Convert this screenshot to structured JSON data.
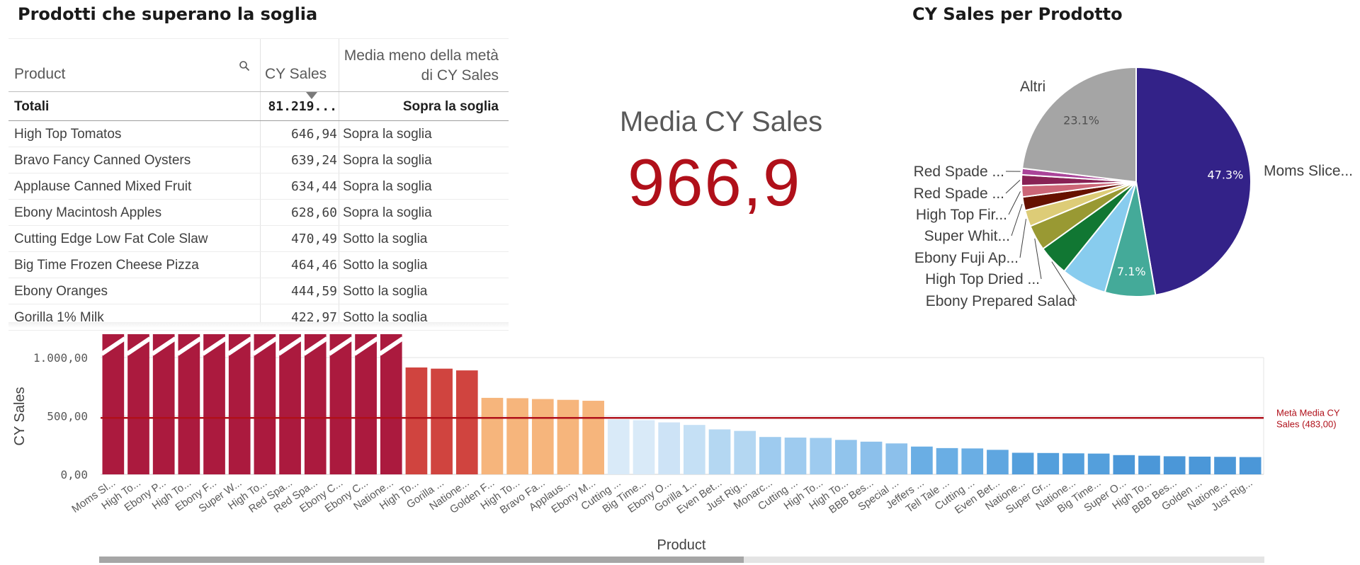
{
  "table": {
    "title": "Prodotti che superano la soglia",
    "headers": {
      "product": "Product",
      "sales": "CY Sales",
      "status": "Media meno della metà di CY Sales"
    },
    "totals": {
      "label": "Totali",
      "sales": "81.219...",
      "status": "Sopra la soglia"
    },
    "rows": [
      {
        "product": "High Top Tomatos",
        "sales": "646,94",
        "status": "Sopra la soglia"
      },
      {
        "product": "Bravo Fancy Canned Oysters",
        "sales": "639,24",
        "status": "Sopra la soglia"
      },
      {
        "product": "Applause Canned Mixed Fruit",
        "sales": "634,44",
        "status": "Sopra la soglia"
      },
      {
        "product": "Ebony Macintosh Apples",
        "sales": "628,60",
        "status": "Sopra la soglia"
      },
      {
        "product": "Cutting Edge Low Fat Cole Slaw",
        "sales": "470,49",
        "status": "Sotto la soglia"
      },
      {
        "product": "Big Time Frozen Cheese Pizza",
        "sales": "464,46",
        "status": "Sotto la soglia"
      },
      {
        "product": "Ebony Oranges",
        "sales": "444,59",
        "status": "Sotto la soglia"
      },
      {
        "product": "Gorilla 1% Milk",
        "sales": "422,97",
        "status": "Sotto la soglia"
      }
    ]
  },
  "kpi": {
    "label": "Media CY Sales",
    "value": "966,9",
    "color": "#b0101a"
  },
  "chart_data": [
    {
      "type": "pie",
      "title": "CY Sales per Prodotto",
      "slices": [
        {
          "label": "Moms Slice...",
          "percent": 47.3,
          "pct_label": "47.3%",
          "color": "#332288"
        },
        {
          "label": "",
          "percent": 7.1,
          "pct_label": "7.1%",
          "color": "#44aa99"
        },
        {
          "label": "",
          "percent": 6.4,
          "pct_label": "",
          "color": "#88ccee"
        },
        {
          "label": "Ebony Prepared Salad",
          "percent": 4.3,
          "pct_label": "",
          "color": "#117733"
        },
        {
          "label": "High Top Dried ...",
          "percent": 3.6,
          "pct_label": "",
          "color": "#999933"
        },
        {
          "label": "Ebony Fuji Ap...",
          "percent": 2.3,
          "pct_label": "",
          "color": "#ddcc77"
        },
        {
          "label": "Super Whit...",
          "percent": 1.9,
          "pct_label": "",
          "color": "#661100"
        },
        {
          "label": "High Top Fir...",
          "percent": 1.6,
          "pct_label": "",
          "color": "#cc6677"
        },
        {
          "label": "Red Spade ...",
          "percent": 1.5,
          "pct_label": "",
          "color": "#882255"
        },
        {
          "label": "Red Spade ...",
          "percent": 0.9,
          "pct_label": "",
          "color": "#aa4499"
        },
        {
          "label": "Altri",
          "percent": 23.1,
          "pct_label": "23.1%",
          "color": "#a5a5a5"
        }
      ]
    },
    {
      "type": "bar",
      "xlabel": "Product",
      "ylabel": "CY Sales",
      "ylim": [
        0,
        1000
      ],
      "yticks": [
        "1.000,00",
        "500,00",
        "0,00"
      ],
      "reference_line": {
        "value": 483,
        "label": "Metà Media CY Sales (483,00)",
        "color": "#b0101a"
      },
      "categories": [
        "Moms Sl...",
        "High To...",
        "Ebony P...",
        "High To...",
        "Ebony F...",
        "Super W...",
        "High To...",
        "Red Spa...",
        "Red Spa...",
        "Ebony C...",
        "Ebony C...",
        "Natione...",
        "High To...",
        "Gorilla ...",
        "Natione...",
        "Golden F...",
        "High To...",
        "Bravo Fa...",
        "Applaus...",
        "Ebony M...",
        "Cutting ...",
        "Big Time...",
        "Ebony O...",
        "Gorilla 1...",
        "Even Bet...",
        "Just Rig...",
        "Monarc...",
        "Cutting ...",
        "High To...",
        "High To...",
        "BBB Bes...",
        "Special ...",
        "Jeffers ...",
        "Tell Tale ...",
        "Cutting ...",
        "Even Bet...",
        "Natione...",
        "Super Gr...",
        "Natione...",
        "Big Time...",
        "Super O...",
        "High To...",
        "BBB Bes...",
        "Golden ...",
        "Natione...",
        "Just Rig..."
      ],
      "values": [
        1200,
        1200,
        1200,
        1200,
        1200,
        1200,
        1200,
        1200,
        1200,
        1200,
        1200,
        1200,
        915,
        905,
        890,
        655,
        652,
        645,
        638,
        630,
        470,
        464,
        445,
        423,
        385,
        372,
        320,
        315,
        312,
        295,
        280,
        265,
        238,
        225,
        222,
        210,
        185,
        183,
        180,
        178,
        165,
        160,
        155,
        152,
        150,
        148
      ],
      "overflow_above": 1000,
      "colors": [
        "#ab1a3e",
        "#ab1a3e",
        "#ab1a3e",
        "#ab1a3e",
        "#ab1a3e",
        "#ab1a3e",
        "#ab1a3e",
        "#ab1a3e",
        "#ab1a3e",
        "#ab1a3e",
        "#ab1a3e",
        "#ab1a3e",
        "#d0443f",
        "#d0443f",
        "#d0443f",
        "#f6b57c",
        "#f6b57c",
        "#f6b57c",
        "#f6b57c",
        "#f6b57c",
        "#d9eaf8",
        "#d9eaf8",
        "#cde3f6",
        "#c5e0f5",
        "#b4d7f2",
        "#b4d7f2",
        "#9ecbef",
        "#9ecbef",
        "#9ecbef",
        "#91c4ec",
        "#8cc0eb",
        "#8cc0eb",
        "#6aaee4",
        "#6aaee4",
        "#6aaee4",
        "#5fa6e0",
        "#549fdc",
        "#549fdc",
        "#549fdc",
        "#549fdc",
        "#4b97d8",
        "#4b97d8",
        "#4b97d8",
        "#4b97d8",
        "#4b97d8",
        "#4b97d8"
      ]
    }
  ]
}
